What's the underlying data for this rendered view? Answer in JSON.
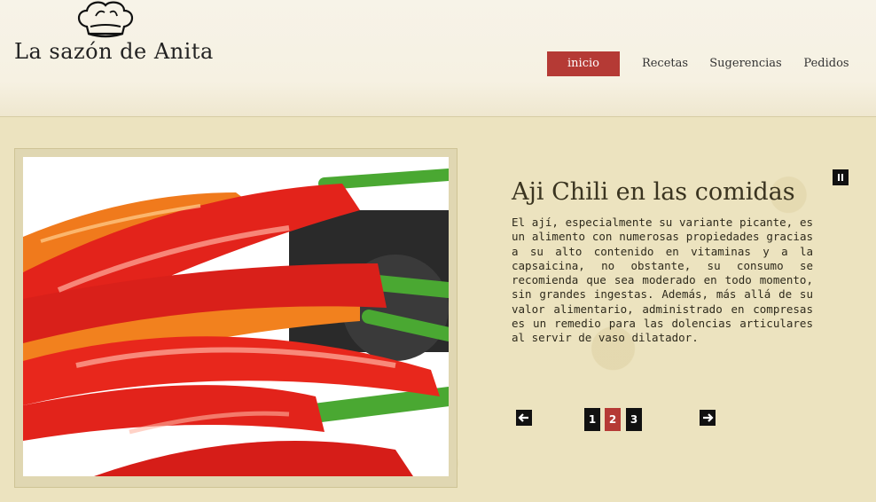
{
  "site": {
    "title": "La sazón de Anita"
  },
  "nav": {
    "items": [
      {
        "label": "inicio",
        "active": true
      },
      {
        "label": "Recetas",
        "active": false
      },
      {
        "label": "Sugerencias",
        "active": false
      },
      {
        "label": "Pedidos",
        "active": false
      }
    ]
  },
  "slider": {
    "title": "Aji Chili en las comidas",
    "text": "El ají, especialmente su variante picante, es un alimento con numerosas propiedades gracias a su alto contenido en vitaminas y a la capsaicina, no obstante, su consumo se recomienda que sea moderado en todo momento, sin grandes ingestas. Además, más allá de su valor alimentario, administrado en compresas es un remedio para las dolencias articulares al servir de vaso dilatador.",
    "pages": [
      "1",
      "2",
      "3"
    ],
    "active_page": "2",
    "icons": {
      "pause": "pause-icon",
      "prev": "arrow-left-icon",
      "next": "arrow-right-icon"
    }
  },
  "colors": {
    "accent": "#b53a35",
    "background": "#ece3bf"
  }
}
